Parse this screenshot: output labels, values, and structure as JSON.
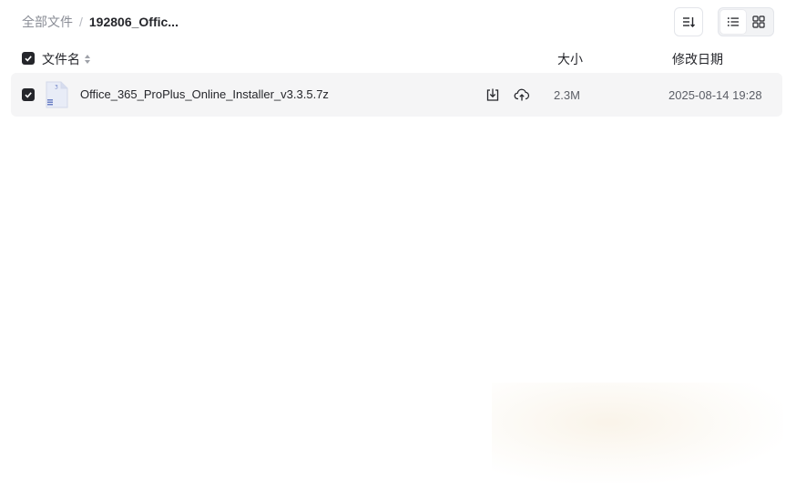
{
  "breadcrumb": {
    "root": "全部文件",
    "separator": "/",
    "current": "192806_Offic..."
  },
  "toolbar": {
    "sort_icon": "sort-lines-icon",
    "view_list_icon": "list-view-icon",
    "view_grid_icon": "grid-view-icon",
    "active_view": "list"
  },
  "table": {
    "columns": {
      "name": "文件名",
      "size": "大小",
      "date": "修改日期"
    },
    "select_all_checked": true,
    "rows": [
      {
        "name": "Office_365_ProPlus_Online_Installer_v3.3.5.7z",
        "size": "2.3M",
        "date": "2025-08-14 19:28",
        "checked": true,
        "file_icon": "archive-file-icon"
      }
    ]
  },
  "colors": {
    "text_primary": "#25262b",
    "text_muted": "#8a8d96",
    "row_hover": "#f5f5f6",
    "checkbox": "#25262b"
  }
}
